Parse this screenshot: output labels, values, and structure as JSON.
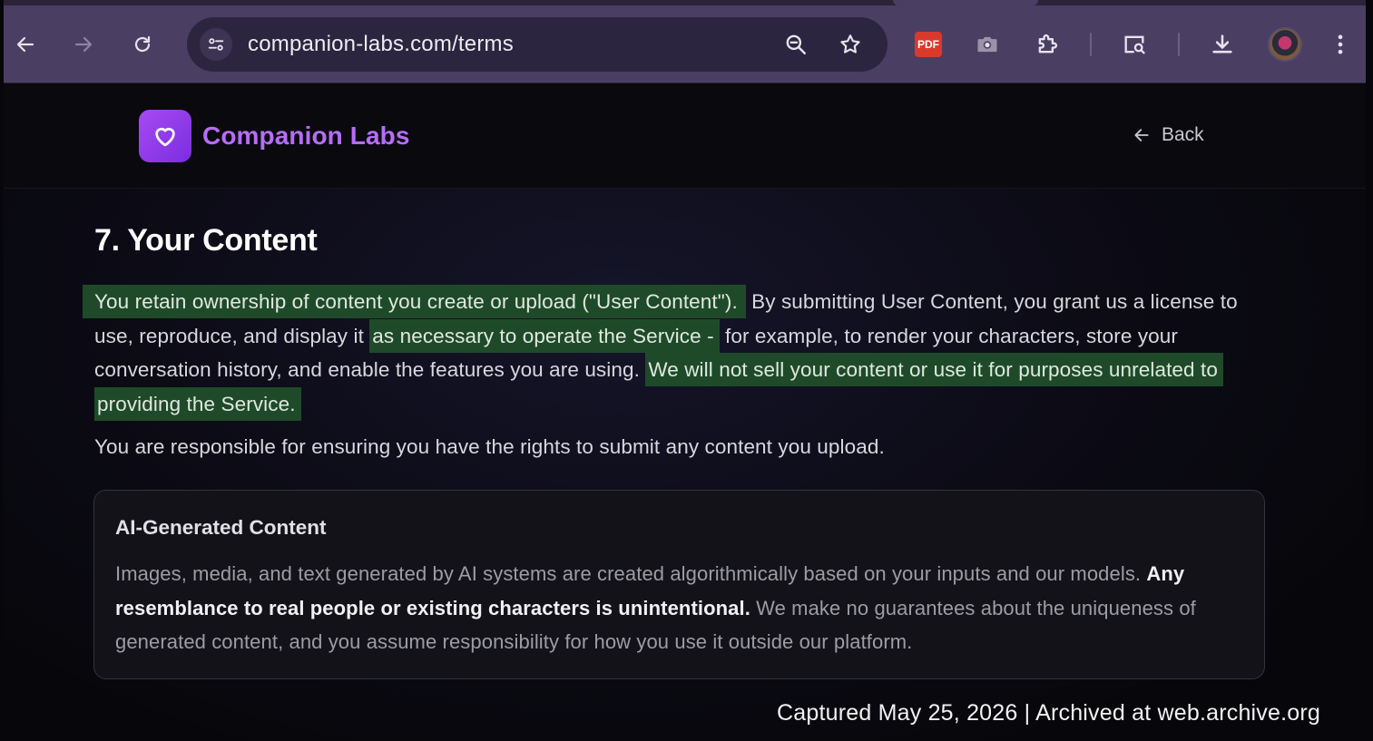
{
  "browser": {
    "url": "companion-labs.com/terms",
    "pdf_label": "PDF"
  },
  "header": {
    "brand": "Companion Labs",
    "back_label": "Back"
  },
  "content": {
    "section_title": "7. Your Content",
    "paragraph1": {
      "hl1": "You retain ownership of content you create or upload (\"User Content\").",
      "text1": " By submitting User Content, you grant us a license to use, reproduce, and display it ",
      "hl2": "as necessary to operate the Service -",
      "text2": " for example, to render your characters, store your conversation history, and enable the features you are using. ",
      "hl3": "We will not sell your content or use it for purposes unrelated to providing the Service."
    },
    "paragraph2": "You are responsible for ensuring you have the rights to submit any content you upload.",
    "callout": {
      "title": "AI-Generated Content",
      "text1": "Images, media, and text generated by AI systems are created algorithmically based on your inputs and our models. ",
      "bold": "Any resemblance to real people or existing characters is unintentional.",
      "text2": " We make no guarantees about the uniqueness of generated content, and you assume responsibility for how you use it outside our platform."
    }
  },
  "caption": "Captured May 25, 2026 | Archived at web.archive.org",
  "colors": {
    "highlight": "#1f4a2a",
    "brand": "#b66df8",
    "chrome": "#4a3e63"
  }
}
